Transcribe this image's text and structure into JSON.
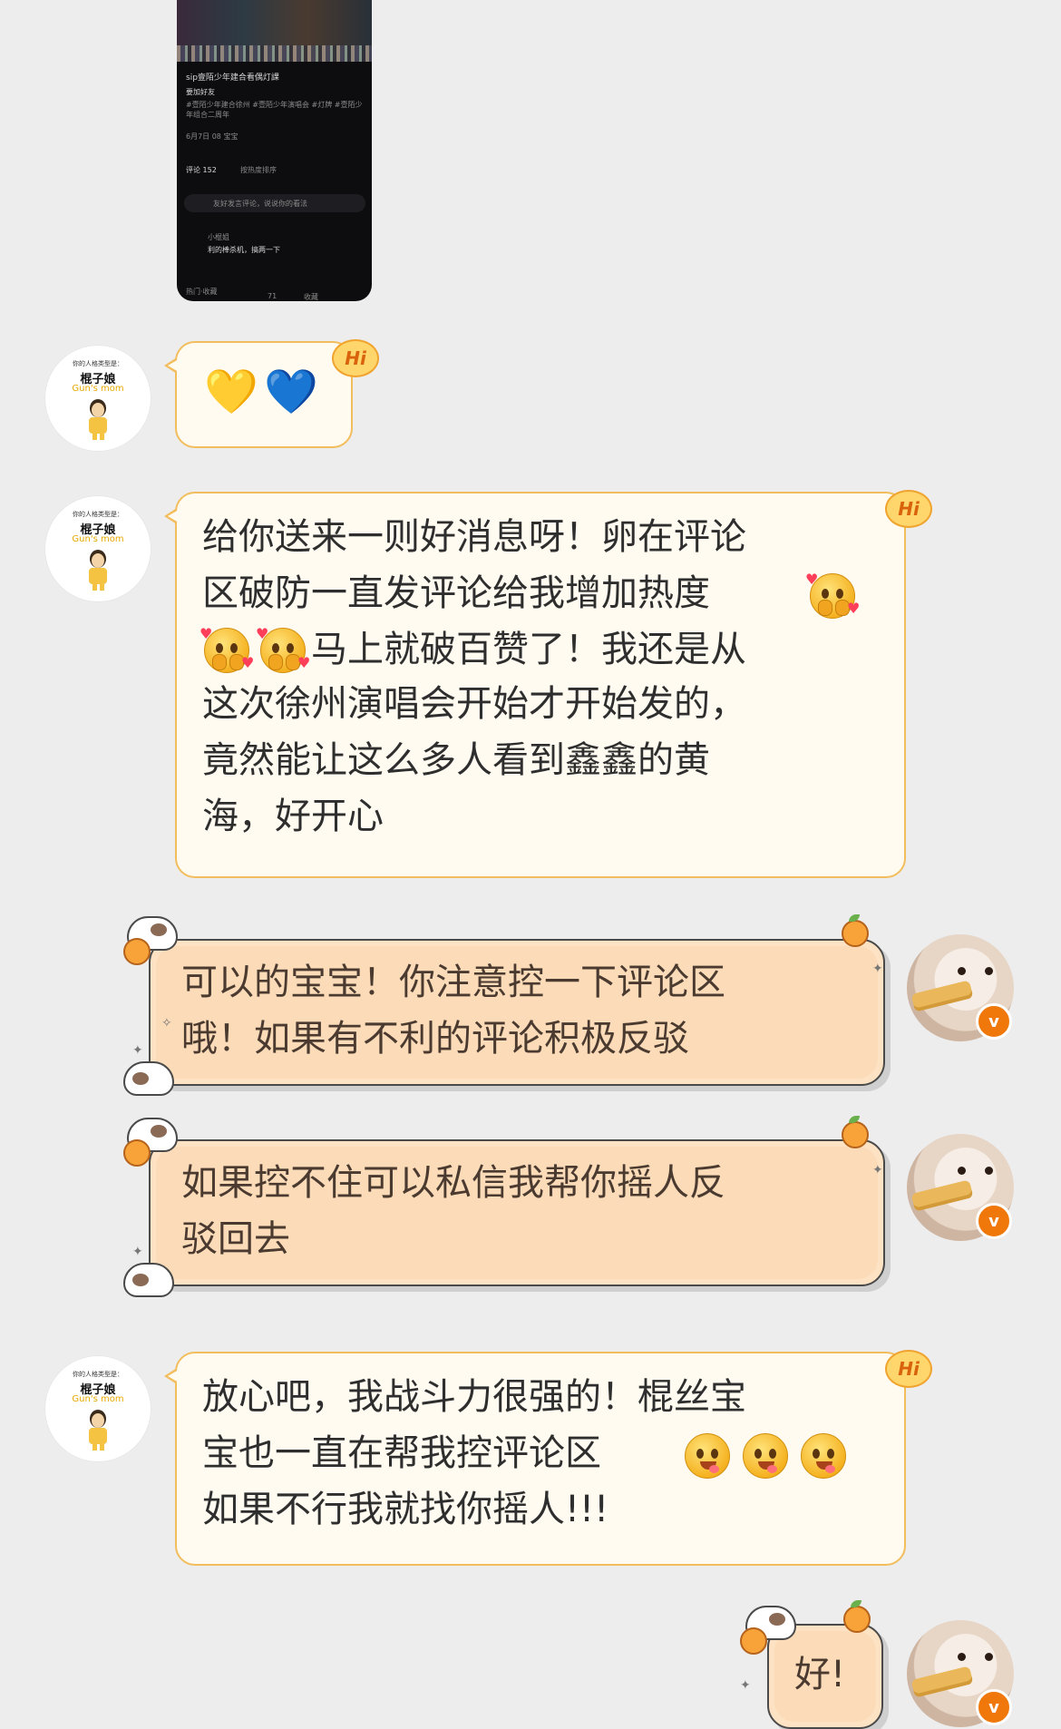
{
  "shared_post": {
    "title": "sip壹陌少年建合看偶灯課",
    "line1": "要加好友",
    "line2": "#壹陌少年建合徐州 #壹陌少年演唱会 #灯牌 #壹陌少年组合二周年",
    "date": "6月7日 08 宝宝",
    "comments": "评论 152",
    "sort": "按热度排序",
    "input_placeholder": "友好发言评论，说说你的看法",
    "commenter": "小棍姐",
    "comment": "利的棒杀机，搞两一下",
    "footer": "热门·收藏",
    "like": "71",
    "fav": "收藏"
  },
  "left_avatar": {
    "caption_top": "你的人格类型是：",
    "caption_name": "棍子娘",
    "caption_en": "Gun's mom"
  },
  "messages": [
    {
      "side": "left",
      "type": "emoji",
      "hearts": [
        "💛",
        "💙"
      ],
      "badge": "Hi"
    },
    {
      "side": "left",
      "badge": "Hi",
      "text_lines": [
        "给你送来一则好消息呀！卵在评论",
        "区破防一直发评论给我增加热度",
        "马上就破百赞了！我还是从",
        "这次徐州演唱会开始才开始发的，",
        "竟然能让这么多人看到鑫鑫的黄",
        "海，好开心"
      ],
      "emoji": "blush-hearts-face"
    },
    {
      "side": "right",
      "text_lines": [
        "可以的宝宝！你注意控一下评论区",
        "哦！如果有不利的评论积极反驳"
      ]
    },
    {
      "side": "right",
      "text_lines": [
        "如果控不住可以私信我帮你摇人反",
        "驳回去"
      ]
    },
    {
      "side": "left",
      "badge": "Hi",
      "text_lines": [
        "放心吧，我战斗力很强的！棍丝宝",
        "宝也一直在帮我控评论区",
        "如果不行我就找你摇人!!!"
      ],
      "emoji": "yum-face"
    },
    {
      "side": "right",
      "text_lines": [
        "好!"
      ]
    }
  ],
  "right_avatar": {
    "badge": "v",
    "icon": "hamster-avatar"
  },
  "colors": {
    "bg": "#ededed",
    "left_bubble_bg": "#fffbf0",
    "left_bubble_border": "#f2bd5d",
    "right_bubble_bg": "#fcdcb8",
    "right_bubble_border": "#4a4a4a",
    "accent_orange": "#f0780a"
  }
}
